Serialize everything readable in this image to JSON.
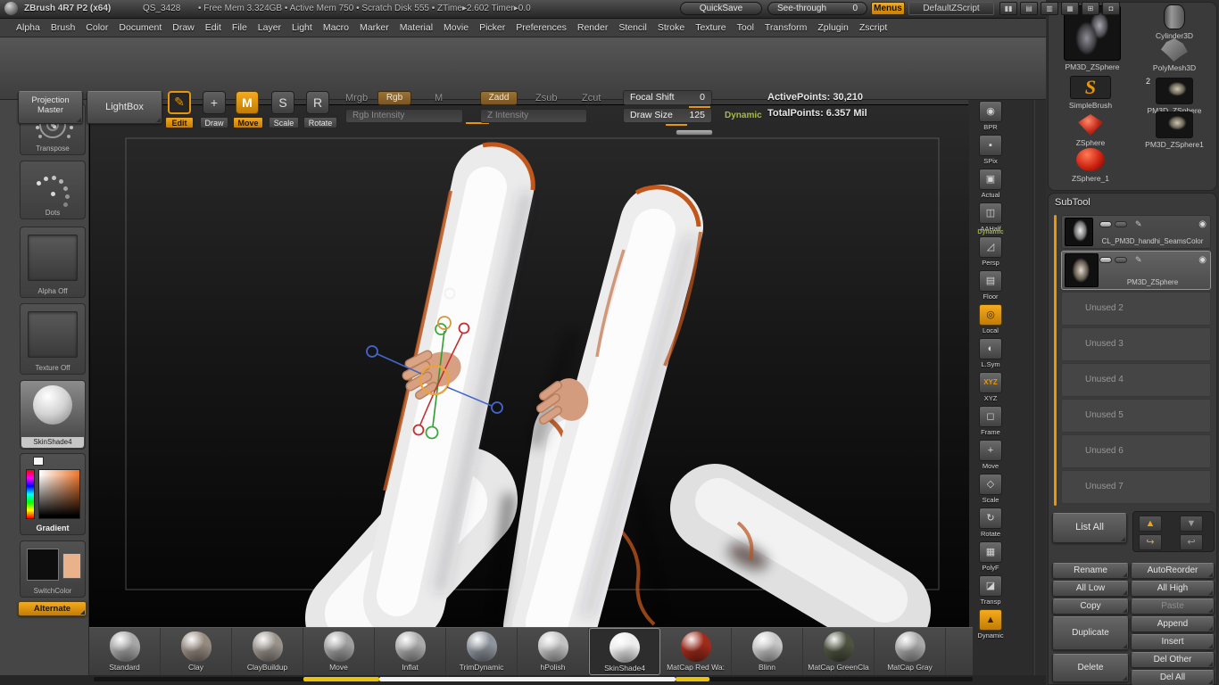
{
  "colors": {
    "accent": "#e8950a",
    "muted_accent": "#8a6430",
    "dynamic_green": "#a7bd3a",
    "seam_orange": "#b8521a",
    "flesh": "#d7a083"
  },
  "title_bar": {
    "app_title": "ZBrush 4R7 P2 (x64)",
    "doc_name": "QS_3428",
    "stats": "•  Free Mem 3.324GB   •  Active Mem 750   •  Scratch Disk 555   •  ZTime▸2.602  Timer▸0.0",
    "quicksave_label": "QuickSave",
    "seethrough_label": "See-through",
    "seethrough_value": "0",
    "menus_label": "Menus",
    "zscript_label": "DefaultZScript",
    "icons": [
      {
        "glyph": "▮▮",
        "name": "sliders"
      },
      {
        "glyph": "▤",
        "name": "tray-left"
      },
      {
        "glyph": "▥",
        "name": "tray-right"
      },
      {
        "glyph": "▦",
        "name": "grid"
      },
      {
        "glyph": "⊞",
        "name": "add-panel"
      },
      {
        "glyph": "◘",
        "name": "lock"
      }
    ]
  },
  "menu_bar": {
    "items": [
      "Alpha",
      "Brush",
      "Color",
      "Document",
      "Draw",
      "Edit",
      "File",
      "Layer",
      "Light",
      "Macro",
      "Marker",
      "Material",
      "Movie",
      "Picker",
      "Preferences",
      "Render",
      "Stencil",
      "Stroke",
      "Texture",
      "Tool",
      "Transform",
      "Zplugin",
      "Zscript"
    ]
  },
  "toolbar": {
    "projection_master_label": "Projection\nMaster",
    "lightbox_label": "LightBox",
    "edit_glyph": "✎",
    "edit_label": "Edit",
    "draw_glyph": "+",
    "draw_label": "Draw",
    "move_glyph": "M",
    "move_label": "Move",
    "scale_glyph": "S",
    "scale_label": "Scale",
    "rotate_glyph": "R",
    "rotate_label": "Rotate",
    "mrgb_label": "Mrgb",
    "rgb_label": "Rgb",
    "m_label": "M",
    "rgb_intensity_label": "Rgb Intensity",
    "zadd_label": "Zadd",
    "zsub_label": "Zsub",
    "zcut_label": "Zcut",
    "z_intensity_label": "Z Intensity",
    "focal_shift_label": "Focal Shift",
    "focal_shift_value": "0",
    "draw_size_label": "Draw Size",
    "draw_size_value": "125",
    "dynamic_label": "Dynamic",
    "active_points": "ActivePoints: 30,210",
    "total_points": "TotalPoints: 6.357 Mil"
  },
  "left_panel": {
    "transpose_label": "Transpose",
    "dots_label": "Dots",
    "alpha_label": "Alpha Off",
    "texture_label": "Texture Off",
    "material_label": "SkinShade4",
    "gradient_label": "Gradient",
    "switch_label": "SwitchColor",
    "alternate_label": "Alternate"
  },
  "right_strip": {
    "persp_dynamic_label": "Dynamic",
    "items": [
      {
        "label": "BPR",
        "glyph": "◉",
        "name": "bpr"
      },
      {
        "label": "SPix",
        "glyph": "▪",
        "name": "spix"
      },
      {
        "label": "Actual",
        "glyph": "▣",
        "name": "actual"
      },
      {
        "label": "AAHalf",
        "glyph": "◫",
        "name": "aahalf"
      },
      {
        "label": "Persp",
        "glyph": "◿",
        "name": "persp"
      },
      {
        "label": "Floor",
        "glyph": "▤",
        "name": "floor"
      },
      {
        "label": "Local",
        "glyph": "◎",
        "name": "local",
        "selected": true
      },
      {
        "label": "L.Sym",
        "glyph": "◐",
        "name": "lsym"
      },
      {
        "label": "XYZ",
        "glyph": "XYZ",
        "name": "xyz",
        "accent": true
      },
      {
        "label": "Frame",
        "glyph": "◻",
        "name": "frame"
      },
      {
        "label": "Move",
        "glyph": "+",
        "name": "move"
      },
      {
        "label": "Scale",
        "glyph": "◇",
        "name": "scale"
      },
      {
        "label": "Rotate",
        "glyph": "↻",
        "name": "rotate"
      },
      {
        "label": "PolyF",
        "glyph": "▦",
        "name": "polyf"
      },
      {
        "label": "Transp",
        "glyph": "◪",
        "name": "transp"
      },
      {
        "label": "Dynamic",
        "glyph": "▲",
        "name": "dynamic",
        "selected": true
      }
    ]
  },
  "tool_palette": {
    "active_tool_label": "PM3D_ZSphere",
    "items": [
      {
        "label": "Cylinder3D",
        "name": "cylinder3d",
        "kind": "cylinder"
      },
      {
        "label": "PolyMesh3D",
        "name": "polymesh3d",
        "kind": "polymesh"
      },
      {
        "label": "SimpleBrush",
        "name": "simplebrush",
        "kind": "simplebrush",
        "glyph": "S"
      },
      {
        "label": "PM3D_ZSphere",
        "name": "pm3d-zsphere-2",
        "kind": "mesh",
        "badge": "2"
      },
      {
        "label": "ZSphere",
        "name": "zsphere",
        "kind": "gem"
      },
      {
        "label": "PM3D_ZSphere1",
        "name": "pm3d-zsphere1",
        "kind": "mesh"
      },
      {
        "label": "ZSphere_1",
        "name": "zsphere-1",
        "kind": "ball"
      }
    ]
  },
  "subtool": {
    "header": "SubTool",
    "items": [
      {
        "label": "CL_PM3D_handhi_SeamsColor",
        "name": "seamscolor",
        "thumb": true
      },
      {
        "label": "PM3D_ZSphere",
        "name": "pm3d-zsphere",
        "thumb": true,
        "selected": true
      },
      {
        "label": "Unused 2",
        "name": "unused-2",
        "kind": "unused"
      },
      {
        "label": "Unused 3",
        "name": "unused-3",
        "kind": "unused"
      },
      {
        "label": "Unused 4",
        "name": "unused-4",
        "kind": "unused"
      },
      {
        "label": "Unused 5",
        "name": "unused-5",
        "kind": "unused"
      },
      {
        "label": "Unused 6",
        "name": "unused-6",
        "kind": "unused"
      },
      {
        "label": "Unused 7",
        "name": "unused-7",
        "kind": "unused"
      }
    ],
    "list_all_label": "List All",
    "nav_up_glyph": "▲",
    "nav_down_glyph": "▼",
    "nav_fwd_glyph": "↪",
    "nav_back_glyph": "↩",
    "rename_label": "Rename",
    "autoreorder_label": "AutoReorder",
    "all_low_label": "All Low",
    "all_high_label": "All High",
    "copy_label": "Copy",
    "paste_label": "Paste",
    "duplicate_label": "Duplicate",
    "append_label": "Append",
    "insert_label": "Insert",
    "delete_label": "Delete",
    "del_other_label": "Del Other",
    "del_all_label": "Del All"
  },
  "brush_bar": {
    "items": [
      {
        "label": "Standard",
        "name": "standard",
        "kind": "brush",
        "color": "#a6a6a6"
      },
      {
        "label": "Clay",
        "name": "clay",
        "kind": "brush",
        "color": "#958a80"
      },
      {
        "label": "ClayBuildup",
        "name": "claybuildup",
        "kind": "brush",
        "color": "#9a938c"
      },
      {
        "label": "Move",
        "name": "move",
        "kind": "brush",
        "color": "#a0a0a0"
      },
      {
        "label": "Inflat",
        "name": "inflat",
        "kind": "brush",
        "color": "#ababab"
      },
      {
        "label": "TrimDynamic",
        "name": "trimdynamic",
        "kind": "brush",
        "color": "#8e949c"
      },
      {
        "label": "hPolish",
        "name": "hpolish",
        "kind": "brush",
        "color": "#c2c2c2"
      },
      {
        "label": "SkinShade4",
        "name": "skinshade4",
        "kind": "material",
        "color": "#ececec",
        "selected": true
      },
      {
        "label": "MatCap Red Wa:",
        "name": "matcap-red-wax",
        "kind": "material",
        "color": "#9e2b1b"
      },
      {
        "label": "Blinn",
        "name": "blinn",
        "kind": "material",
        "color": "#c6c6c6"
      },
      {
        "label": "MatCap GreenCla",
        "name": "matcap-greenclay",
        "kind": "material",
        "color": "#4d5340"
      },
      {
        "label": "MatCap Gray",
        "name": "matcap-gray",
        "kind": "material",
        "color": "#a9a9a9"
      }
    ]
  }
}
